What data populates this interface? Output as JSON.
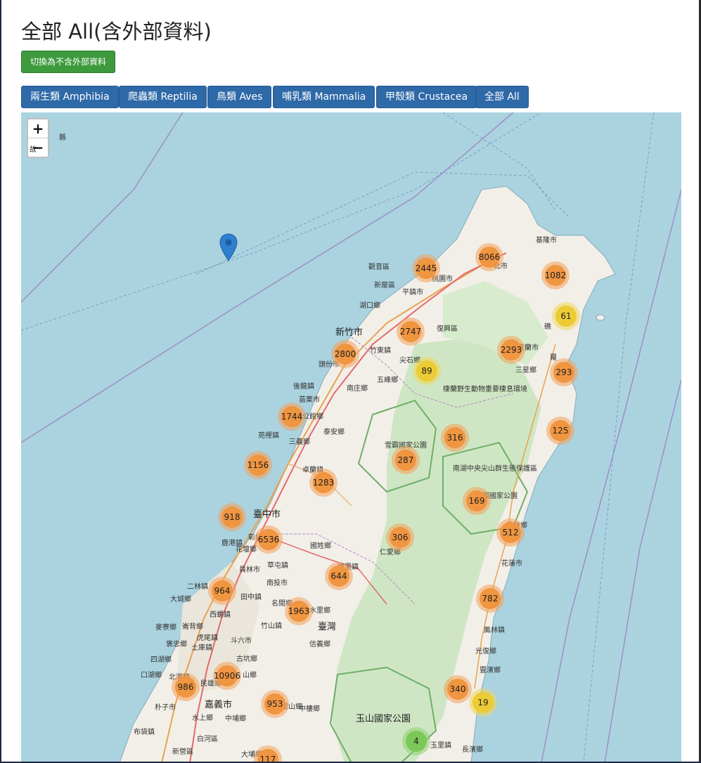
{
  "page": {
    "title": "全部 All(含外部資料)"
  },
  "toggle_button": {
    "label": "切換為不含外部資料"
  },
  "filters": [
    {
      "label": "兩生類 Amphibia"
    },
    {
      "label": "爬蟲類 Reptilia"
    },
    {
      "label": "鳥類 Aves"
    },
    {
      "label": "哺乳類 Mammalia"
    },
    {
      "label": "甲殼類 Crustacea"
    },
    {
      "label": "全部 All"
    }
  ],
  "map": {
    "zoom_in": "+",
    "zoom_out": "−",
    "colors": {
      "large": "#f09540",
      "medium": "#eccb34",
      "small": "#7bc75a",
      "sea": "#aad3df",
      "land": "#f2efe9",
      "forest": "#cfe6c4"
    },
    "clusters": [
      {
        "value": "2445",
        "size": "large"
      },
      {
        "value": "8066",
        "size": "large"
      },
      {
        "value": "1082",
        "size": "large"
      },
      {
        "value": "61",
        "size": "medium"
      },
      {
        "value": "2747",
        "size": "large"
      },
      {
        "value": "2293",
        "size": "large"
      },
      {
        "value": "2800",
        "size": "large"
      },
      {
        "value": "89",
        "size": "medium"
      },
      {
        "value": "293",
        "size": "large"
      },
      {
        "value": "1744",
        "size": "large"
      },
      {
        "value": "316",
        "size": "large"
      },
      {
        "value": "125",
        "size": "large"
      },
      {
        "value": "287",
        "size": "large"
      },
      {
        "value": "1156",
        "size": "large"
      },
      {
        "value": "1283",
        "size": "large"
      },
      {
        "value": "169",
        "size": "large"
      },
      {
        "value": "918",
        "size": "large"
      },
      {
        "value": "6536",
        "size": "large"
      },
      {
        "value": "306",
        "size": "large"
      },
      {
        "value": "512",
        "size": "large"
      },
      {
        "value": "644",
        "size": "large"
      },
      {
        "value": "964",
        "size": "large"
      },
      {
        "value": "782",
        "size": "large"
      },
      {
        "value": "1963",
        "size": "large"
      },
      {
        "value": "10906",
        "size": "large"
      },
      {
        "value": "986",
        "size": "large"
      },
      {
        "value": "340",
        "size": "large"
      },
      {
        "value": "953",
        "size": "large"
      },
      {
        "value": "19",
        "size": "medium"
      },
      {
        "value": "4",
        "size": "small"
      },
      {
        "value": "117",
        "size": "large"
      }
    ],
    "labels": [
      "基隆市",
      "北市",
      "桃園市",
      "觀音區",
      "新屋區",
      "平鎮市",
      "湖口鄉",
      "新竹市",
      "竹東鎮",
      "尖石鄉",
      "復興區",
      "宜蘭市",
      "礁",
      "三星鄉",
      "羅",
      "頭份市",
      "五峰鄉",
      "南庄鄉",
      "後龍鎮",
      "苗栗市",
      "通霄",
      "公館鄉",
      "泰安鄉",
      "苑裡鎮",
      "三義鄉",
      "雪霸國家公園",
      "棲蘭野生動物重要棲息環境",
      "南湖中央尖山群生態保護區",
      "太魯閣國家公園",
      "卓蘭鎮",
      "臺中市",
      "彰化市",
      "鹿港鎮",
      "花壇鄉",
      "員林市",
      "國姓鄉",
      "仁愛鄉",
      "秀林鄉",
      "埔里鎮",
      "花蓮市",
      "草屯鎮",
      "南投市",
      "二林鎮",
      "大城鄉",
      "田中鎮",
      "名間鄉",
      "水里鄉",
      "西螺鎮",
      "竹山鎮",
      "臺灣",
      "麥寮鄉",
      "崙背鄉",
      "土庫鎮",
      "褒忠鄉",
      "虎尾鎮",
      "斗六市",
      "信義鄉",
      "鳳林鎮",
      "光復鄉",
      "四湖鄉",
      "古坑鄉",
      "口湖鄉",
      "北港鎮",
      "民雄鄉",
      "山鄉",
      "豐濱鄉",
      "朴子市",
      "嘉義市",
      "阿里山鄉",
      "水上鄉",
      "中埔鄉",
      "玉山國家公園",
      "布袋鎮",
      "白河區",
      "新營區",
      "玉里鎮",
      "長濱鄉",
      "大埔鄉",
      "中樓鄉",
      "縣",
      "故"
    ]
  }
}
